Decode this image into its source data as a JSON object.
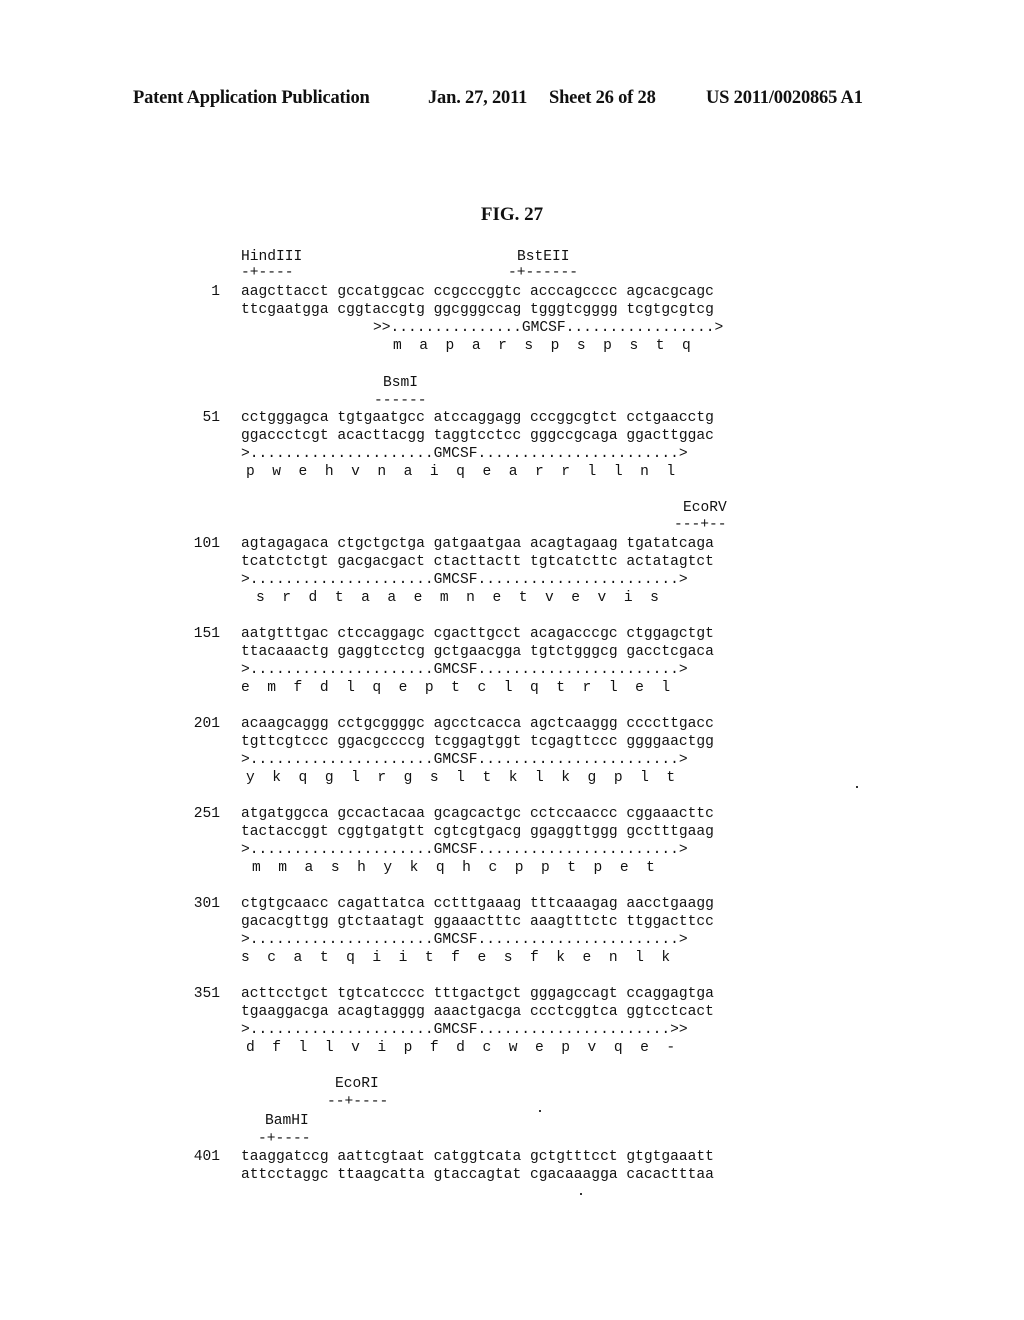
{
  "header": {
    "left": "Patent Application Publication",
    "date": "Jan. 27, 2011",
    "sheet": "Sheet 26 of 28",
    "number": "US 2011/0020865 A1"
  },
  "figure": {
    "title": "FIG. 27"
  },
  "blocks": [
    {
      "position": "1",
      "sites": [
        {
          "label": "HindIII",
          "marker": "-+----"
        },
        {
          "label": "BstEII",
          "marker": "-+------"
        }
      ],
      "top_strand": "aagcttacct gccatggcac ccgcccggtc acccagcccc agcacgcagc",
      "bottom_strand": "ttcgaatgga cggtaccgtg ggcgggccag tgggtcgggg tcgtgcgtcg",
      "feature": ">>...............GMCSF.................>",
      "translation": "m  a  p  a  r  s  p  s  p  s  t  q"
    },
    {
      "position": "51",
      "sites": [
        {
          "label": "BsmI",
          "marker": "------"
        }
      ],
      "top_strand": "cctgggagca tgtgaatgcc atccaggagg cccggcgtct cctgaacctg",
      "bottom_strand": "ggaccctcgt acacttacgg taggtcctcc gggccgcaga ggacttggac",
      "feature": ">.....................GMCSF.......................>",
      "translation": "p  w  e  h  v  n  a  i  q  e  a  r  r  l  l  n  l"
    },
    {
      "position": "101",
      "sites": [
        {
          "label": "EcoRV",
          "marker": "---+--"
        }
      ],
      "top_strand": "agtagagaca ctgctgctga gatgaatgaa acagtagaag tgatatcaga",
      "bottom_strand": "tcatctctgt gacgacgact ctacttactt tgtcatcttc actatagtct",
      "feature": ">.....................GMCSF.......................>",
      "translation": "s  r  d  t  a  a  e  m  n  e  t  v  e  v  i  s"
    },
    {
      "position": "151",
      "sites": [],
      "top_strand": "aatgtttgac ctccaggagc cgacttgcct acagacccgc ctggagctgt",
      "bottom_strand": "ttacaaactg gaggtcctcg gctgaacgga tgtctgggcg gacctcgaca",
      "feature": ">.....................GMCSF.......................>",
      "translation": "e  m  f  d  l  q  e  p  t  c  l  q  t  r  l  e  l"
    },
    {
      "position": "201",
      "sites": [],
      "top_strand": "acaagcaggg cctgcggggc agcctcacca agctcaaggg ccccttgacc",
      "bottom_strand": "tgttcgtccc ggacgccccg tcggagtggt tcgagttccc ggggaactgg",
      "feature": ">.....................GMCSF.......................>",
      "translation": "y  k  q  g  l  r  g  s  l  t  k  l  k  g  p  l  t"
    },
    {
      "position": "251",
      "sites": [],
      "top_strand": "atgatggcca gccactacaa gcagcactgc cctccaaccc cggaaacttc",
      "bottom_strand": "tactaccggt cggtgatgtt cgtcgtgacg ggaggttggg gcctttgaag",
      "feature": ">.....................GMCSF.......................>",
      "translation": "m  m  a  s  h  y  k  q  h  c  p  p  t  p  e  t"
    },
    {
      "position": "301",
      "sites": [],
      "top_strand": "ctgtgcaacc cagattatca cctttgaaag tttcaaagag aacctgaagg",
      "bottom_strand": "gacacgttgg gtctaatagt ggaaactttc aaagtttctc ttggacttcc",
      "feature": ">.....................GMCSF.......................>",
      "translation": "s  c  a  t  q  i  i  t  f  e  s  f  k  e  n  l  k"
    },
    {
      "position": "351",
      "sites": [],
      "top_strand": "acttcctgct tgtcatcccc tttgactgct gggagccagt ccaggagtga",
      "bottom_strand": "tgaaggacga acagtagggg aaactgacga ccctcggtca ggtcctcact",
      "feature": ">.....................GMCSF......................>>",
      "translation": "d  f  l  l  v  i  p  f  d  c  w  e  p  v  q  e  -"
    },
    {
      "position": "401",
      "sites": [
        {
          "label": "EcoRI",
          "marker": "--+----"
        },
        {
          "label": "BamHI",
          "marker": "-+----"
        }
      ],
      "top_strand": "taaggatccg aattcgtaat catggtcata gctgtttcct gtgtgaaatt",
      "bottom_strand": "attcctaggc ttaagcatta gtaccagtat cgacaaagga cacactttaa"
    }
  ]
}
